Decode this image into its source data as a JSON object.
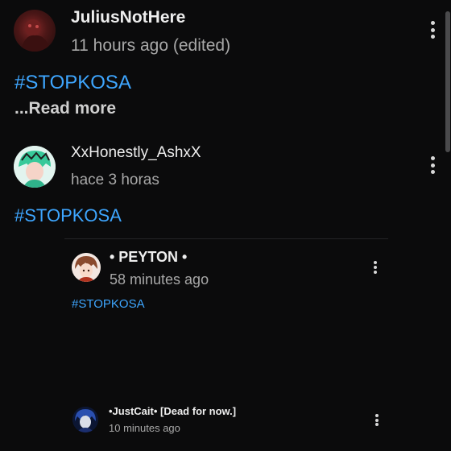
{
  "comments": [
    {
      "author": "JuliusNotHere",
      "time": "11 hours ago (edited)",
      "text": "#STOPKOSA",
      "read_more": "...Read more",
      "avatar_icon": "avatar-dark-red"
    },
    {
      "author": "XxHonestly_AshxX",
      "time": "hace 3 horas",
      "text": "#STOPKOSA",
      "avatar_icon": "avatar-green-hair"
    }
  ],
  "replies": [
    {
      "author": "• PEYTON •",
      "time": "58 minutes ago",
      "text": "#STOPKOSA",
      "avatar_icon": "avatar-brown-hair"
    },
    {
      "author": "•JustCait• [Dead for now.]",
      "time": "10 minutes ago",
      "avatar_icon": "avatar-blue-dark"
    }
  ],
  "colors": {
    "background": "#0b0b0c",
    "hashtag": "#3ea6ff",
    "secondary_text": "#a8a8a8"
  }
}
